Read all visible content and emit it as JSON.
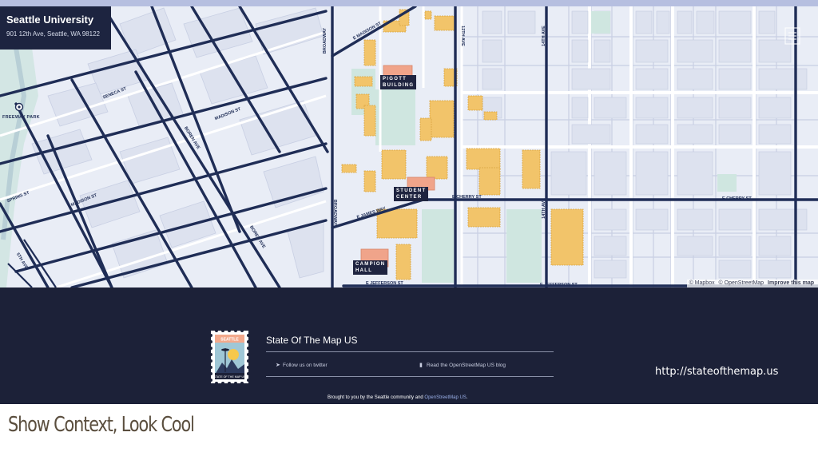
{
  "map": {
    "place_card": {
      "title": "Seattle University",
      "address": "901 12th Ave, Seattle, WA 98122"
    },
    "labels": {
      "freeway_park": "FREEWAY PARK",
      "seneca_st": "SENECA ST",
      "madison_st_left": "MADISON ST",
      "madison_st_mid": "MADISON ST",
      "spring_st": "SPRING ST",
      "boren_ave_top": "BOREN AVE",
      "boren_ave_bottom": "BOREN AVE",
      "fifth_ave": "5TH AVE",
      "e_madison_st": "E MADISON ST",
      "broadway_top": "BROADWAY",
      "broadway_bottom": "BROADWAY",
      "twelfth_ave": "12TH AVE",
      "fourteenth_ave_top": "14TH AVE",
      "fourteenth_ave_bottom": "14TH AVE",
      "e_james_way": "E JAMES WAY",
      "e_cherry_st_mid": "E CHERRY ST",
      "e_cherry_st_right": "E CHERRY ST",
      "e_jefferson_st_left": "E JEFFERSON ST",
      "e_jefferson_st_right": "E JEFFERSON ST"
    },
    "buildings": {
      "pigott_line1": "PIGOTT",
      "pigott_line2": "BUILDING",
      "student_line1": "STUDENT",
      "student_line2": "CENTER",
      "campion_line1": "CAMPION",
      "campion_line2": "HALL"
    },
    "attribution": {
      "mapbox": "© Mapbox",
      "osm": "© OpenStreetMap",
      "improve": "Improve this map"
    },
    "layers_icon": "layers-icon"
  },
  "footer": {
    "title": "State Of The Map US",
    "twitter_link": "Follow us on twitter",
    "blog_link": "Read the OpenStreetMap US blog",
    "credit_prefix": "Brought to you by the Seattle community and",
    "credit_link": "OpenStreetMap US",
    "credit_suffix": ".",
    "stamp": {
      "top_text": "SEATTLE",
      "bottom_text": "STATE OF THE MAP US"
    }
  },
  "url": "http://stateofthemap.us",
  "slide_title": "Show Context, Look Cool",
  "colors": {
    "road": "#1f2d56",
    "campus_building": "#f2c46a",
    "highlight_building": "#f0a48a",
    "map_background": "#e9edf6",
    "footer_background": "#1c2138"
  }
}
